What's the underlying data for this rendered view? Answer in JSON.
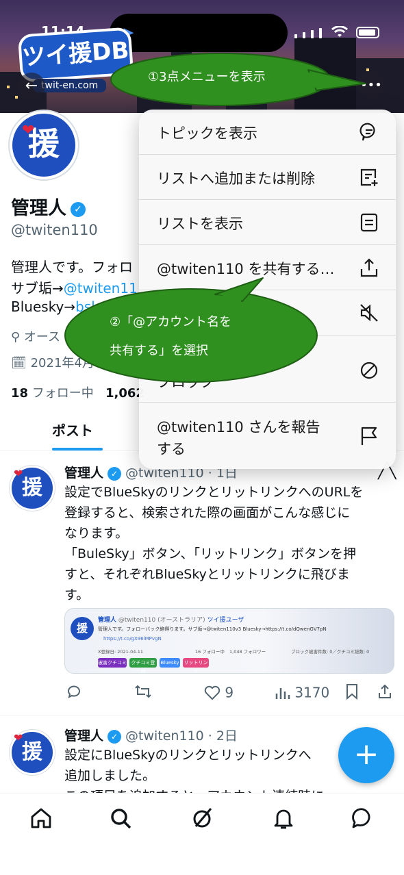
{
  "status": {
    "time": "11:14"
  },
  "banner": {
    "brand": "ツイ援DB",
    "brand_sub": "twit-en.com",
    "back_icon": "arrow-left-icon",
    "more_icon": "ellipsis-icon"
  },
  "profile": {
    "avatar_char": "援",
    "name": "管理人",
    "handle": "@twiten110",
    "bio_line1": "管理人です。フォロ",
    "bio_line2_prefix": "サブ垢→",
    "bio_line2_link": "@twiten11",
    "bio_line3_prefix": "Bluesky→",
    "bio_line3_link": "bsk",
    "location": "オース",
    "joined": "2021年4月",
    "following_count": "18",
    "following_label": "フォロー中",
    "followers_count": "1,062"
  },
  "tabs": {
    "posts": "ポスト"
  },
  "menu": {
    "items": [
      {
        "label": "トピックを表示",
        "icon": "topic-icon"
      },
      {
        "label": "リストへ追加または削除",
        "icon": "list-add-icon"
      },
      {
        "label": "リストを表示",
        "icon": "list-icon"
      },
      {
        "label": "@twiten110 を共有する…",
        "icon": "share-icon"
      },
      {
        "label": "",
        "icon": "mute-icon"
      },
      {
        "label": "ブロック",
        "icon": "block-icon"
      },
      {
        "label_line1": "@twiten110 さんを報告",
        "label_line2": "する",
        "icon": "flag-icon"
      }
    ]
  },
  "callouts": {
    "step1": "①3点メニューを表示",
    "step2_line1": "②「@アカウント名を",
    "step2_line2": "共有する」を選択"
  },
  "posts": [
    {
      "name": "管理人",
      "handle_time": "@twiten110 · 1日",
      "lines": [
        "設定でBlueSkyのリンクとリットリンクへのURLを",
        "登録すると、検索された際の画面がこんな感じに",
        "なります。",
        "「BuleSky」ボタン、「リットリンク」ボタンを押",
        "すと、それぞれBlueSkyとリットリンクに飛びま",
        "す。"
      ],
      "embed": {
        "name": "管理人",
        "handle": "@twiten110",
        "region": "(オーストラリア)",
        "badge": "ツイ援ユーザ",
        "bio": "管理人です。フォローバック絶得ります。サブ垢→@twiten110v3 Bluesky→https://t.co/dQwenGV7pN",
        "link": "https://t.co/gX96lMPvgN",
        "registered": "X登録日: 2021-04-11",
        "following": "16 フォロー中",
        "followers": "1,048 フォロワー",
        "block": "ブロック被害件数: 0／クチコミ総数: 0",
        "chips": [
          {
            "label": "被害クチコミ",
            "color": "#7b2fbf"
          },
          {
            "label": "クチコミ登録",
            "color": "#2f9e44"
          },
          {
            "label": "Bluesky",
            "color": "#3d8bfd"
          },
          {
            "label": "リットリンク",
            "color": "#e64980"
          }
        ]
      },
      "likes": "9",
      "views": "3170"
    },
    {
      "name": "管理人",
      "handle_time": "@twiten110 · 2日",
      "lines": [
        "設定にBlueSkyのリンクとリットリンクへ",
        "追加しました。",
        "この項目を追加すると、アカウント連結時に"
      ]
    }
  ],
  "fab": "+",
  "nav": [
    "home-icon",
    "search-icon",
    "grok-icon",
    "notifications-icon",
    "messages-icon"
  ]
}
